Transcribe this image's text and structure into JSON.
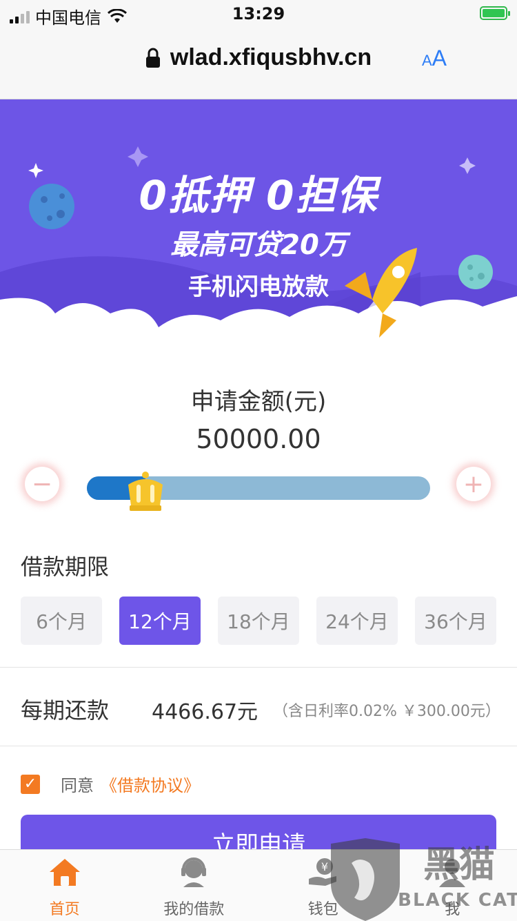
{
  "status_bar": {
    "carrier": "中国电信",
    "time": "13:29"
  },
  "browser": {
    "url": "wlad.xfiqusbhv.cn",
    "text_size_small": "A",
    "text_size_large": "A"
  },
  "banner": {
    "line1": "0抵押 0担保",
    "line2": "最高可贷20万",
    "line3": "手机闪电放款",
    "bg_color": "#6d55e6"
  },
  "amount": {
    "label": "申请金额(元)",
    "value": "50000.00",
    "slider_fraction": 0.17,
    "minus_symbol": "−",
    "plus_symbol": "+"
  },
  "term": {
    "title": "借款期限",
    "options": [
      "6个月",
      "12个月",
      "18个月",
      "24个月",
      "36个月"
    ],
    "selected_index": 1
  },
  "repayment": {
    "label": "每期还款",
    "value": "4466.67元",
    "note": "（含日利率0.02% ￥300.00元）"
  },
  "agreement": {
    "checked": true,
    "check_mark": "✓",
    "text": "同意",
    "link": "《借款协议》"
  },
  "apply_button": {
    "label": "立即申请"
  },
  "tabbar": {
    "items": [
      {
        "label": "首页",
        "icon": "home-icon",
        "active": true
      },
      {
        "label": "我的借款",
        "icon": "customer-service-icon",
        "active": false
      },
      {
        "label": "钱包",
        "icon": "wallet-icon",
        "active": false
      },
      {
        "label": "我",
        "icon": "profile-icon",
        "active": false
      }
    ]
  },
  "watermark": {
    "brand": "黑猫",
    "brand_en": "BLACK CAT"
  },
  "colors": {
    "accent": "#6e55e8",
    "orange": "#f37a22",
    "slider_fill": "#1e77c8",
    "slider_track": "#8db9d6"
  }
}
